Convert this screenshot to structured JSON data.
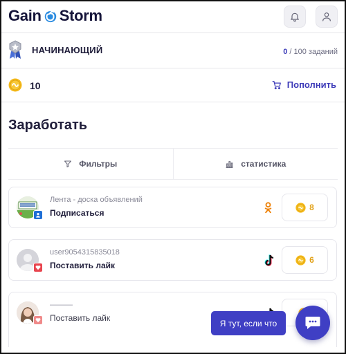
{
  "header": {
    "logo_left": "Gain",
    "logo_right": "Storm",
    "icons": [
      "bell-icon",
      "user-icon"
    ]
  },
  "level": {
    "title": "НАЧИНАЮЩИЙ",
    "done": "0",
    "total": " / 100 заданий"
  },
  "balance": {
    "value": "10",
    "topup_label": "Пополнить"
  },
  "section": {
    "title": "Заработать"
  },
  "tabs": [
    {
      "label": "Фильтры",
      "icon": "filter-icon"
    },
    {
      "label": "статистика",
      "icon": "chart-icon"
    }
  ],
  "tasks": [
    {
      "name": "Лента - доска объявлений",
      "action": "Подписаться",
      "network": "odnoklassniki-icon",
      "reward": "8",
      "badge_color": "#1f6fd6"
    },
    {
      "name": "user9054315835018",
      "action": "Поставить лайк",
      "network": "tiktok-icon",
      "reward": "6",
      "badge_color": "#e8454f"
    },
    {
      "name": "———",
      "action": "Поставить лайк",
      "network": "tiktok-icon",
      "reward": "",
      "badge_color": "#f08a8a"
    }
  ],
  "chat": {
    "pill_text": "Я тут, если что"
  },
  "colors": {
    "accent": "#3f3fc4",
    "coin": "#e2a21a",
    "text": "#1f1d3a"
  }
}
